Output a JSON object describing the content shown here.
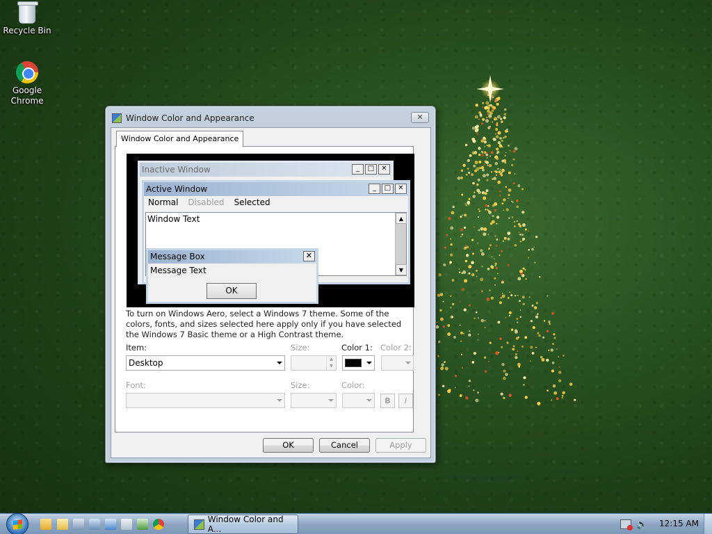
{
  "desktop": {
    "icons": [
      {
        "label": "Recycle Bin",
        "icon": "recycle-bin-icon"
      },
      {
        "label": "Google Chrome",
        "icon": "chrome-icon"
      }
    ]
  },
  "dialog": {
    "title": "Window Color and Appearance",
    "close_label": "✕",
    "tab_label": "Window Color and Appearance",
    "preview": {
      "inactive_title": "Inactive Window",
      "active_title": "Active Window",
      "menu_normal": "Normal",
      "menu_disabled": "Disabled",
      "menu_selected": "Selected",
      "window_text": "Window Text",
      "msgbox_title": "Message Box",
      "msgbox_text": "Message Text",
      "msgbox_ok": "OK"
    },
    "description": "To turn on Windows Aero, select a Windows 7 theme.  Some of the colors, fonts, and sizes selected here apply only if you have selected the Windows 7 Basic theme or a High Contrast theme.",
    "item_label": "Item:",
    "item_value": "Desktop",
    "size_label": "Size:",
    "size_value": "",
    "color1_label": "Color 1:",
    "color1_value": "#000000",
    "color2_label": "Color 2:",
    "font_label": "Font:",
    "font_value": "",
    "font_size_label": "Size:",
    "font_color_label": "Color:",
    "bold_label": "B",
    "italic_label": "I",
    "ok_label": "OK",
    "cancel_label": "Cancel",
    "apply_label": "Apply"
  },
  "taskbar": {
    "active_window": "Window Color and A...",
    "clock": "12:15 AM"
  }
}
